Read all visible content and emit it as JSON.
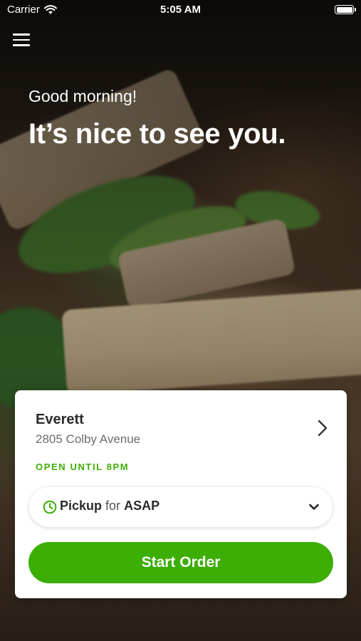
{
  "status_bar": {
    "carrier": "Carrier",
    "time": "5:05 AM",
    "icons": [
      "wifi-icon",
      "battery-icon"
    ]
  },
  "nav": {
    "menu_icon": "hamburger-icon"
  },
  "hero": {
    "greeting": "Good morning!",
    "headline": "It’s nice to see you."
  },
  "store": {
    "name": "Everett",
    "address": "2805 Colby Avenue",
    "hours": "OPEN UNTIL 8PM"
  },
  "order_type": {
    "method": "Pickup",
    "connector": "for",
    "time": "ASAP",
    "icons": [
      "clock-icon",
      "chevron-down-icon"
    ]
  },
  "actions": {
    "start_order": "Start Order"
  },
  "colors": {
    "accent": "#3cae05",
    "card": "#ffffff",
    "text": "#2b2b2b",
    "muted": "#6d6d6d"
  }
}
